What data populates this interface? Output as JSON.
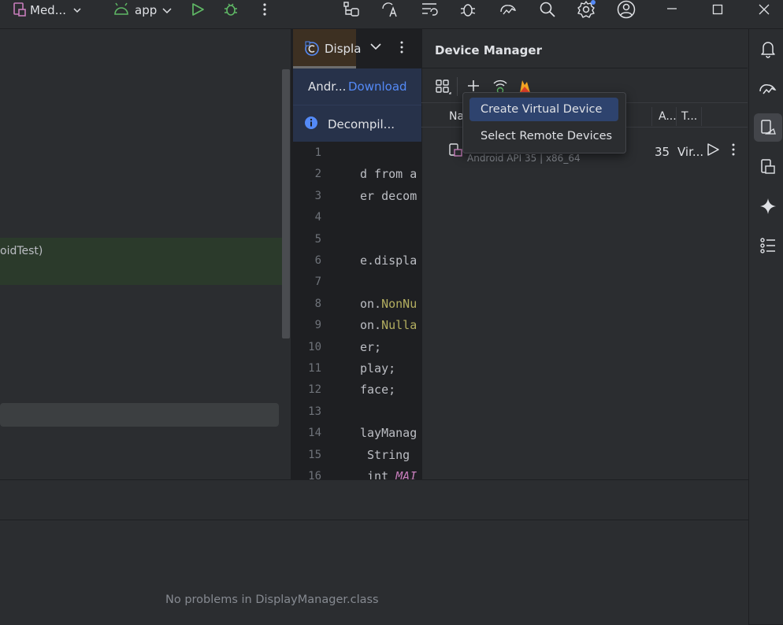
{
  "titlebar": {
    "project": "Med...",
    "run_config": "app"
  },
  "editor_tab": {
    "label": "Displa"
  },
  "banners": {
    "download_prefix": "Andr...",
    "download_link": "Download",
    "decompiled": "Decompil..."
  },
  "left_editor": {
    "fragment": "oidTest)"
  },
  "code": {
    "lines": [
      {
        "n": "1",
        "t": ""
      },
      {
        "n": "2",
        "t": "d from a"
      },
      {
        "n": "3",
        "t": "er decom"
      },
      {
        "n": "4",
        "t": ""
      },
      {
        "n": "5",
        "t": ""
      },
      {
        "n": "6",
        "t": "e.displa"
      },
      {
        "n": "7",
        "t": ""
      },
      {
        "n": "8",
        "t": "on.",
        "y": "NonNu"
      },
      {
        "n": "9",
        "t": "on.",
        "y": "Nulla"
      },
      {
        "n": "10",
        "t": "er;"
      },
      {
        "n": "11",
        "t": "play;"
      },
      {
        "n": "12",
        "t": "face;"
      },
      {
        "n": "13",
        "t": ""
      },
      {
        "n": "14",
        "t": "layManag"
      },
      {
        "n": "15",
        "t": " String"
      },
      {
        "n": "16",
        "t": " int ",
        "p": "MAI"
      }
    ]
  },
  "device_manager": {
    "title": "Device Manager",
    "columns": {
      "name": "Na",
      "api": "A...",
      "type": "T..."
    },
    "device": {
      "subtitle": "Android API 35 | x86_64",
      "api": "35",
      "type": "Vir..."
    },
    "menu": [
      "Create Virtual Device",
      "Select Remote Devices"
    ]
  },
  "problems": {
    "status": "No problems in DisplayManager.class"
  },
  "colors": {
    "accent": "#2e436e",
    "link": "#548af7",
    "run": "#5fb865"
  }
}
